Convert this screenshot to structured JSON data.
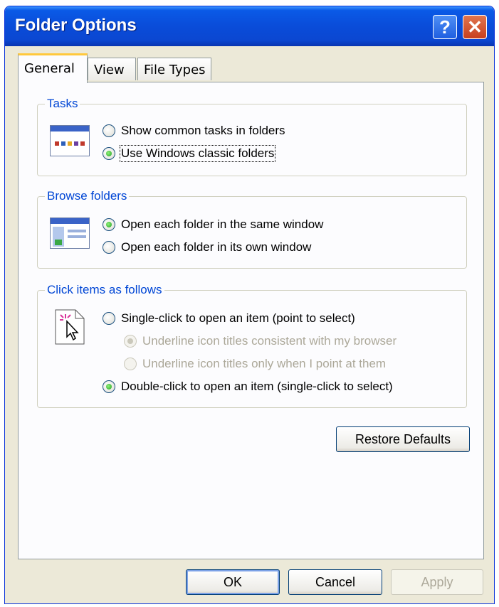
{
  "window": {
    "title": "Folder Options"
  },
  "titlebar": {
    "help_glyph": "?",
    "close_glyph": "✕"
  },
  "tabs": [
    {
      "label": "General",
      "active": true
    },
    {
      "label": "View",
      "active": false
    },
    {
      "label": "File Types",
      "active": false
    }
  ],
  "tasks": {
    "legend": "Tasks",
    "options": [
      {
        "label": "Show common tasks in folders",
        "checked": false
      },
      {
        "label": "Use Windows classic folders",
        "checked": true
      }
    ]
  },
  "browse": {
    "legend": "Browse folders",
    "options": [
      {
        "label": "Open each folder in the same window",
        "checked": true
      },
      {
        "label": "Open each folder in its own window",
        "checked": false
      }
    ]
  },
  "click": {
    "legend": "Click items as follows",
    "options": [
      {
        "label": "Single-click to open an item (point to select)",
        "checked": false
      },
      {
        "label": "Underline icon titles consistent with my browser",
        "checked": true,
        "disabled": true
      },
      {
        "label": "Underline icon titles only when I point at them",
        "checked": false,
        "disabled": true
      },
      {
        "label": "Double-click to open an item (single-click to select)",
        "checked": true
      }
    ]
  },
  "buttons": {
    "restore_defaults": "Restore Defaults",
    "ok": "OK",
    "cancel": "Cancel",
    "apply": "Apply"
  },
  "icons": {
    "tasks": "classic-folder-window-icon",
    "browse": "folder-window-icon",
    "click": "pointer-click-icon"
  },
  "colors": {
    "titlebar": "#0a4cd9",
    "legend": "#0046d5",
    "dialog_bg": "#ece9d8",
    "tab_accent": "#ffc83c"
  }
}
